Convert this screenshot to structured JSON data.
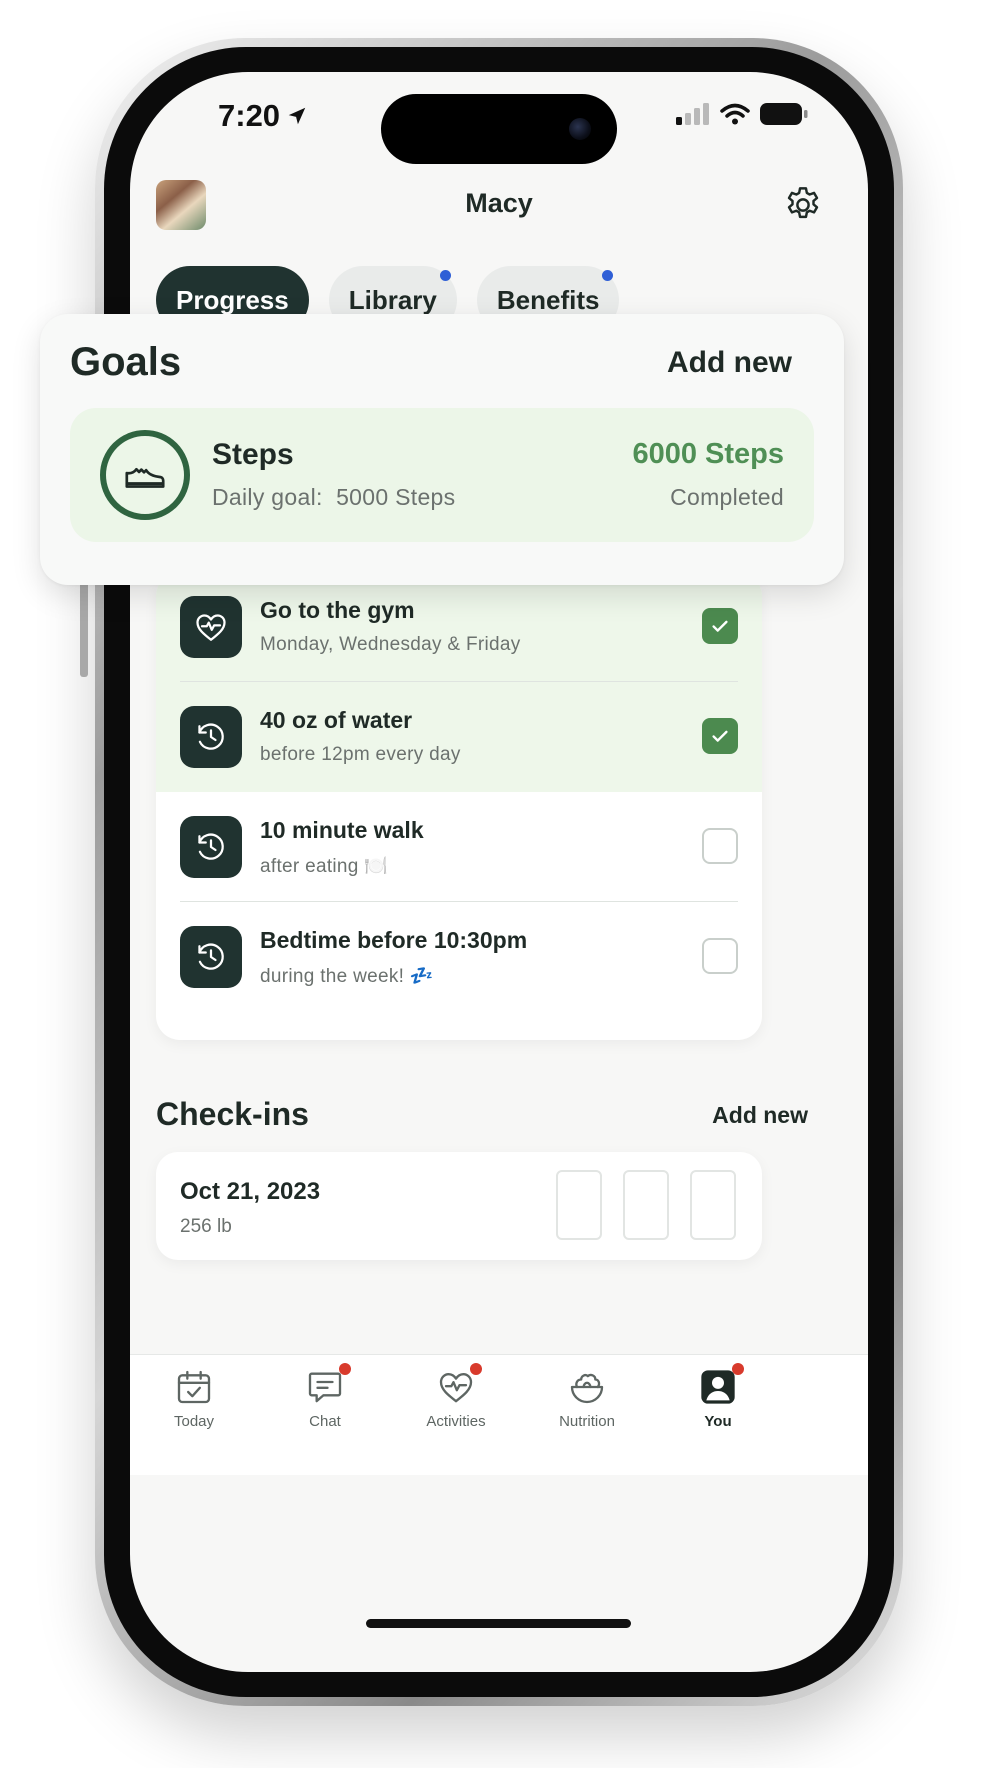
{
  "status_bar": {
    "time": "7:20"
  },
  "header": {
    "user_name": "Macy"
  },
  "tabs": [
    {
      "label": "Progress",
      "active": true,
      "has_dot": false
    },
    {
      "label": "Library",
      "active": false,
      "has_dot": true
    },
    {
      "label": "Benefits",
      "active": false,
      "has_dot": true
    }
  ],
  "goals_card": {
    "title": "Goals",
    "add_label": "Add new",
    "featured": {
      "name": "Steps",
      "goal_label": "Daily goal:",
      "goal_value": "5000 Steps",
      "value": "6000 Steps",
      "status": "Completed",
      "icon": "sneaker-icon"
    }
  },
  "goal_items": [
    {
      "title": "Go to the gym",
      "subtitle": "Monday, Wednesday & Friday",
      "icon": "heart-pulse-icon",
      "checked": true
    },
    {
      "title": "40 oz of water",
      "subtitle": "before 12pm every day",
      "icon": "history-clock-icon",
      "checked": true
    },
    {
      "title": "10 minute walk",
      "subtitle": "after eating 🍽️",
      "icon": "history-clock-icon",
      "checked": false
    },
    {
      "title": "Bedtime before 10:30pm",
      "subtitle": "during the week! 💤",
      "icon": "history-clock-icon",
      "checked": false
    }
  ],
  "checkins": {
    "title": "Check-ins",
    "add_label": "Add new",
    "entries": [
      {
        "date": "Oct 21, 2023",
        "weight": "256 lb"
      }
    ]
  },
  "tab_bar": [
    {
      "label": "Today",
      "icon": "calendar-check-icon",
      "badge": false,
      "active": false
    },
    {
      "label": "Chat",
      "icon": "chat-icon",
      "badge": true,
      "active": false
    },
    {
      "label": "Activities",
      "icon": "heart-pulse-icon",
      "badge": true,
      "active": false
    },
    {
      "label": "Nutrition",
      "icon": "salad-bowl-icon",
      "badge": false,
      "active": false
    },
    {
      "label": "You",
      "icon": "profile-icon",
      "badge": true,
      "active": true
    }
  ],
  "colors": {
    "accent_dark": "#203330",
    "success_green": "#4c8a4f",
    "steps_value_green": "#4f8f55",
    "done_row_bg": "#eef7ea",
    "notification_dot": "#2f5fd6",
    "badge_red": "#d83a2c"
  }
}
